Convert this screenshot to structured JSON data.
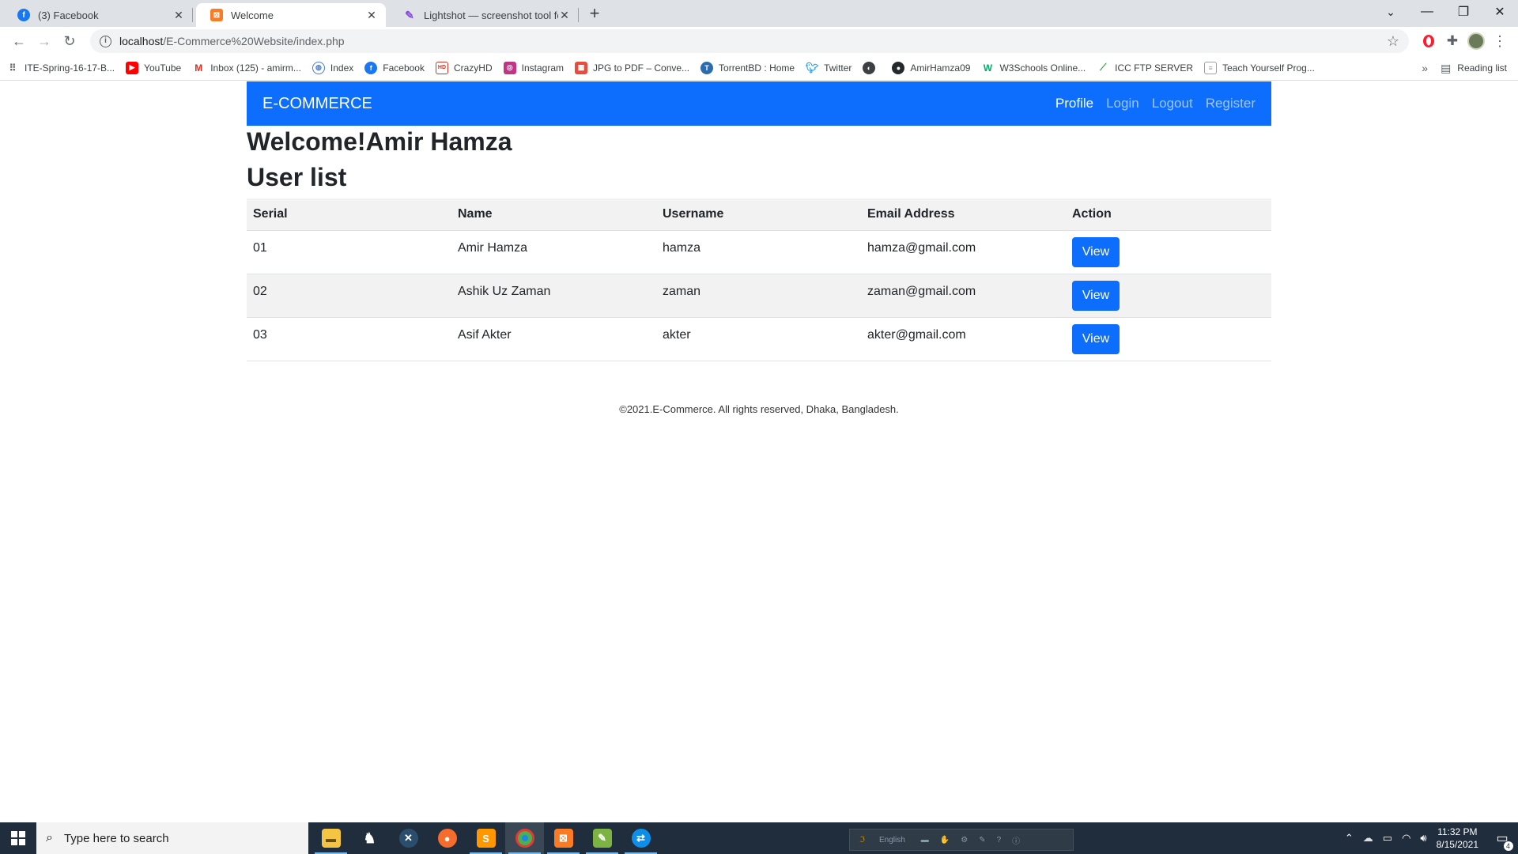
{
  "browser": {
    "tabs": [
      {
        "title": "(3) Facebook",
        "active": false,
        "icon": "facebook-icon",
        "color": "#1877f2"
      },
      {
        "title": "Welcome",
        "active": true,
        "icon": "xampp-icon",
        "color": "#fb7a24"
      },
      {
        "title": "Lightshot — screenshot tool for M",
        "active": false,
        "icon": "lightshot-feather-icon",
        "color": "#8a4fd6"
      }
    ],
    "url_host": "localhost",
    "url_path": "/E-Commerce%20Website/index.php",
    "bookmarks": [
      {
        "label": "ITE-Spring-16-17-B...",
        "icon": "apps-icon",
        "color": "#5f6368"
      },
      {
        "label": "YouTube",
        "icon": "youtube-icon",
        "color": "#ff0000"
      },
      {
        "label": "Inbox (125) - amirm...",
        "icon": "gmail-icon",
        "color": "#d93025"
      },
      {
        "label": "Index",
        "icon": "globe-icon",
        "color": "#4a7bd0"
      },
      {
        "label": "Facebook",
        "icon": "facebook-icon",
        "color": "#1877f2"
      },
      {
        "label": "CrazyHD",
        "icon": "hd-icon",
        "color": "#c0392b"
      },
      {
        "label": "Instagram",
        "icon": "instagram-icon",
        "color": "#c13584"
      },
      {
        "label": "JPG to PDF – Conve...",
        "icon": "pdf-icon",
        "color": "#e74c3c"
      },
      {
        "label": "TorrentBD : Home",
        "icon": "torrentbd-icon",
        "color": "#2b6cb0"
      },
      {
        "label": "Twitter",
        "icon": "twitter-icon",
        "color": "#1da1f2"
      },
      {
        "label": "",
        "icon": "world-icon",
        "color": "#3c4043"
      },
      {
        "label": "AmirHamza09",
        "icon": "github-icon",
        "color": "#24292e"
      },
      {
        "label": "W3Schools Online...",
        "icon": "w3schools-icon",
        "color": "#04aa6d"
      },
      {
        "label": "ICC FTP SERVER",
        "icon": "icc-icon",
        "color": "#2e9e44"
      },
      {
        "label": "Teach Yourself Prog...",
        "icon": "page-icon",
        "color": "#9aa0a6"
      }
    ],
    "reading_list": "Reading list"
  },
  "navbar": {
    "brand": "E-COMMERCE",
    "links": [
      {
        "label": "Profile",
        "active": true
      },
      {
        "label": "Login",
        "active": false
      },
      {
        "label": "Logout",
        "active": false
      },
      {
        "label": "Register",
        "active": false
      }
    ]
  },
  "welcome": {
    "prefix": "Welcome!",
    "name": "Amir Hamza"
  },
  "user_list": {
    "title": "User list",
    "headers": [
      "Serial",
      "Name",
      "Username",
      "Email Address",
      "Action"
    ],
    "rows": [
      {
        "serial": "01",
        "name": "Amir Hamza",
        "username": "hamza",
        "email": "hamza@gmail.com",
        "action": "View"
      },
      {
        "serial": "02",
        "name": "Ashik Uz Zaman",
        "username": "zaman",
        "email": "zaman@gmail.com",
        "action": "View"
      },
      {
        "serial": "03",
        "name": "Asif Akter",
        "username": "akter",
        "email": "akter@gmail.com",
        "action": "View"
      }
    ]
  },
  "footer": "©2021.E-Commerce. All rights reserved, Dhaka, Bangladesh.",
  "taskbar": {
    "search_placeholder": "Type here to search",
    "language": "English",
    "time": "11:32 PM",
    "date": "8/15/2021",
    "notification_count": "4"
  },
  "colors": {
    "primary": "#0d6efd",
    "taskbar": "#1f2d3d"
  }
}
